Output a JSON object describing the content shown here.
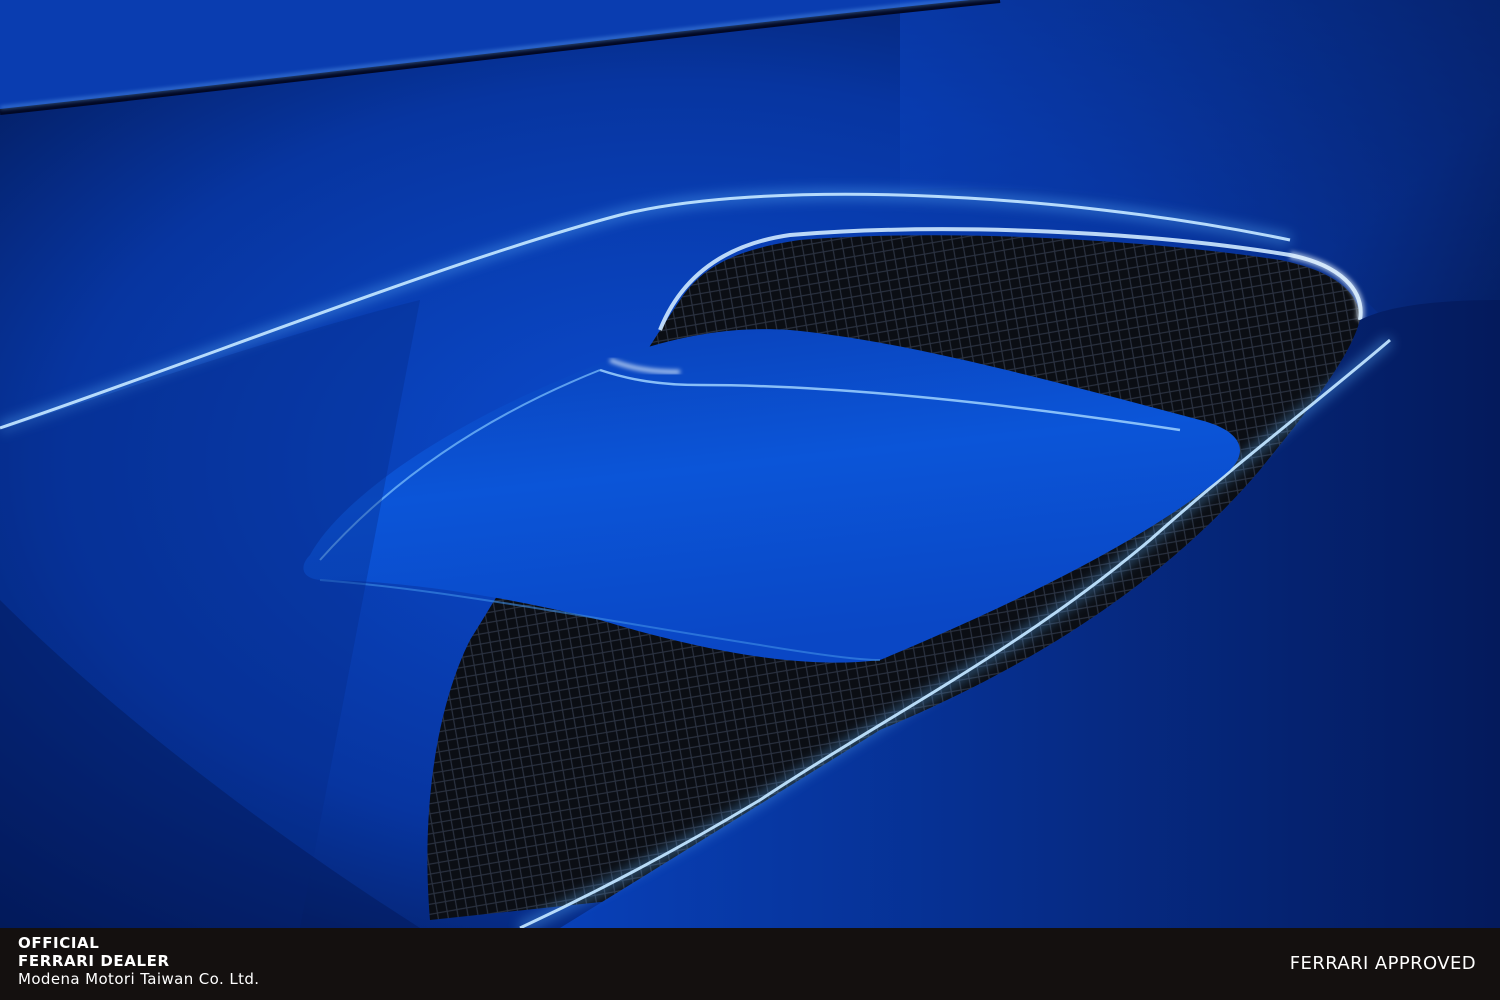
{
  "photo": {
    "subject": "blue-car-body-air-intake"
  },
  "footer": {
    "dealer_line1": "OFFICIAL",
    "dealer_line2": "FERRARI DEALER",
    "company": "Modena Motori Taiwan Co. Ltd.",
    "approved": "FERRARI APPROVED"
  },
  "colors": {
    "paint": "#0a3fb3",
    "paint_dark": "#03113a",
    "highlight": "#7fc4ff",
    "footer_bg": "#14100f"
  }
}
